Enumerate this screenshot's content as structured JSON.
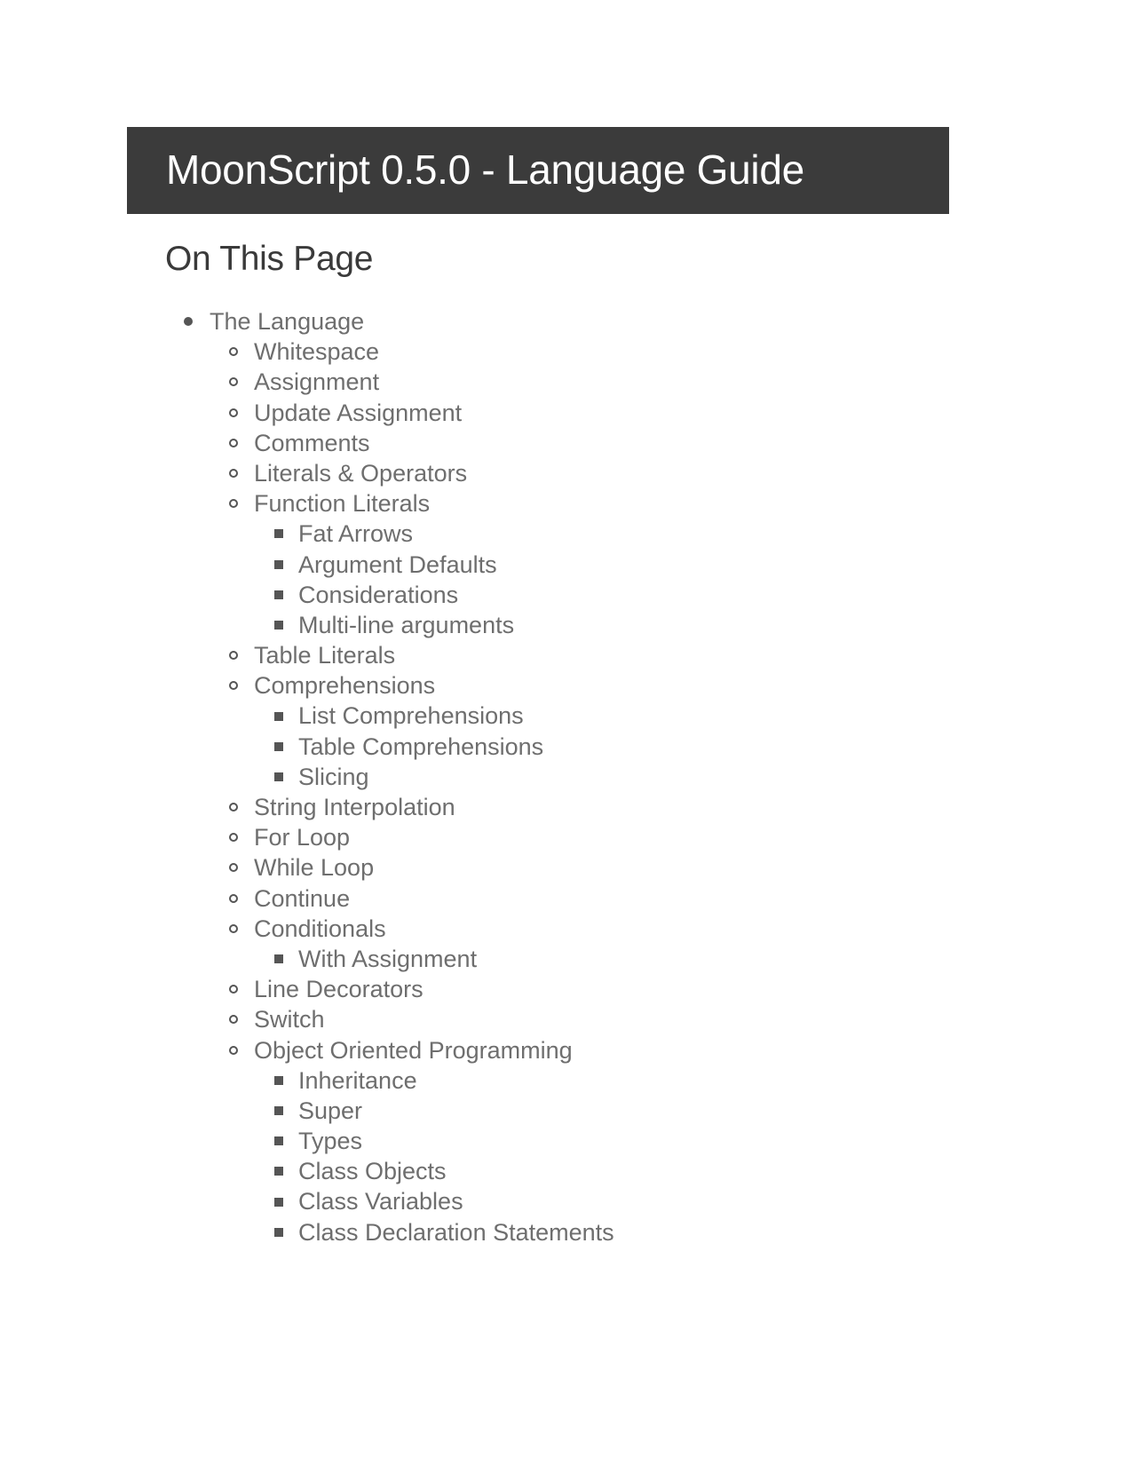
{
  "header": {
    "title": "MoonScript 0.5.0 - Language Guide"
  },
  "toc": {
    "heading": "On This Page",
    "items": [
      {
        "level": 1,
        "label": "The Language"
      },
      {
        "level": 2,
        "label": "Whitespace"
      },
      {
        "level": 2,
        "label": "Assignment"
      },
      {
        "level": 2,
        "label": "Update Assignment"
      },
      {
        "level": 2,
        "label": "Comments"
      },
      {
        "level": 2,
        "label": "Literals & Operators"
      },
      {
        "level": 2,
        "label": "Function Literals"
      },
      {
        "level": 3,
        "label": "Fat Arrows"
      },
      {
        "level": 3,
        "label": "Argument Defaults"
      },
      {
        "level": 3,
        "label": "Considerations"
      },
      {
        "level": 3,
        "label": "Multi-line arguments"
      },
      {
        "level": 2,
        "label": "Table Literals"
      },
      {
        "level": 2,
        "label": "Comprehensions"
      },
      {
        "level": 3,
        "label": "List Comprehensions"
      },
      {
        "level": 3,
        "label": "Table Comprehensions"
      },
      {
        "level": 3,
        "label": "Slicing"
      },
      {
        "level": 2,
        "label": "String Interpolation"
      },
      {
        "level": 2,
        "label": "For Loop"
      },
      {
        "level": 2,
        "label": "While Loop"
      },
      {
        "level": 2,
        "label": "Continue"
      },
      {
        "level": 2,
        "label": "Conditionals"
      },
      {
        "level": 3,
        "label": "With Assignment"
      },
      {
        "level": 2,
        "label": "Line Decorators"
      },
      {
        "level": 2,
        "label": "Switch"
      },
      {
        "level": 2,
        "label": "Object Oriented Programming"
      },
      {
        "level": 3,
        "label": "Inheritance"
      },
      {
        "level": 3,
        "label": "Super"
      },
      {
        "level": 3,
        "label": "Types"
      },
      {
        "level": 3,
        "label": "Class Objects"
      },
      {
        "level": 3,
        "label": "Class Variables"
      },
      {
        "level": 3,
        "label": "Class Declaration Statements"
      }
    ]
  }
}
